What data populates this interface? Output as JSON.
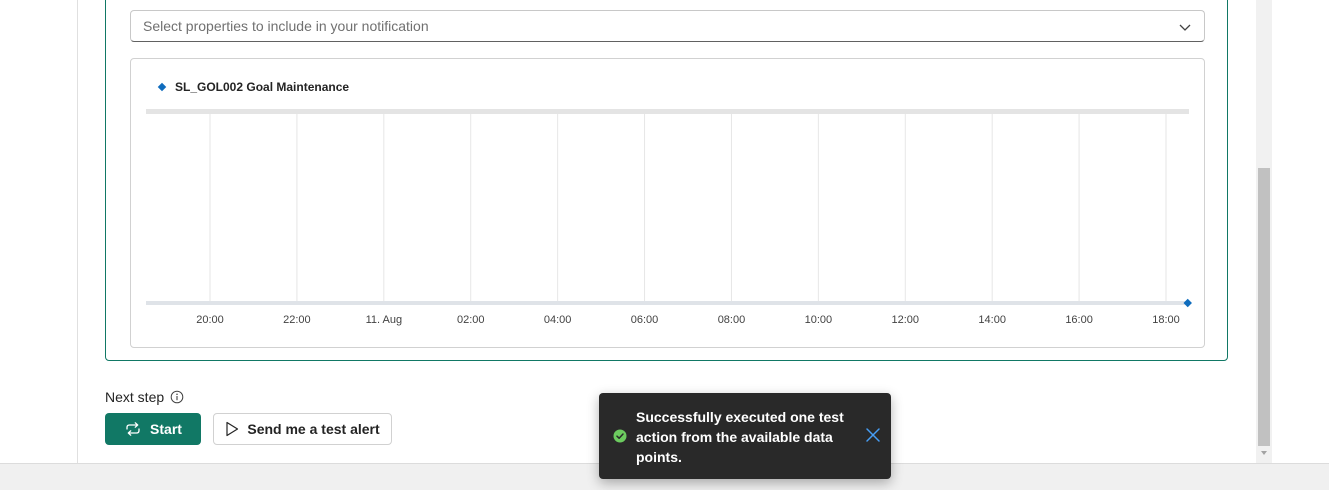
{
  "notification": {
    "select_placeholder": "Select properties to include in your notification"
  },
  "chart_data": {
    "type": "line",
    "series": [
      {
        "name": "SL_GOL002 Goal Maintenance",
        "color": "#0f6cbd",
        "points": [
          {
            "x": "18:30",
            "y": 0
          }
        ]
      }
    ],
    "x_ticks": [
      "20:00",
      "22:00",
      "11. Aug",
      "02:00",
      "04:00",
      "06:00",
      "08:00",
      "10:00",
      "12:00",
      "14:00",
      "16:00",
      "18:00"
    ],
    "grid": true,
    "legend_position": "top-left"
  },
  "next_step": {
    "label": "Next step",
    "start_label": "Start",
    "test_alert_label": "Send me a test alert"
  },
  "toast": {
    "message": "Successfully executed one test action from the available data points.",
    "status": "success",
    "accent": "#6ccb5f"
  },
  "theme": {
    "primary": "#117865",
    "series_color": "#0f6cbd"
  }
}
